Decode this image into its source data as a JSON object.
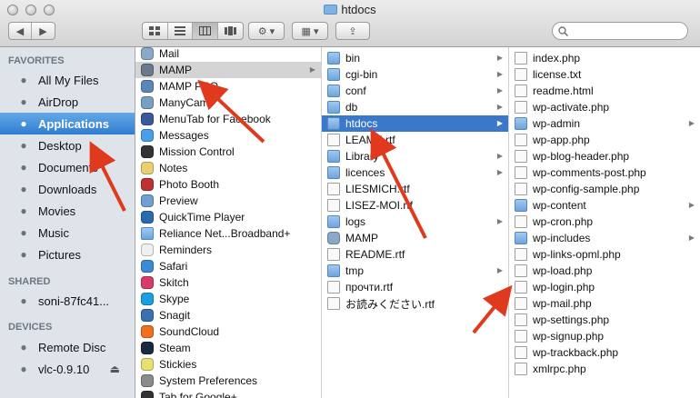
{
  "window": {
    "title": "htdocs"
  },
  "toolbar": {
    "view_icons": [
      "icon-view-icon",
      "list-view-icon",
      "column-view-icon",
      "coverflow-view-icon"
    ],
    "action_label": "⚙ ▾",
    "arrange_label": "▦ ▾",
    "share_label": "⇪"
  },
  "search": {
    "placeholder": ""
  },
  "sidebar": {
    "favorites_label": "FAVORITES",
    "favorites": [
      {
        "label": "All My Files",
        "icon": "all-files-icon"
      },
      {
        "label": "AirDrop",
        "icon": "airdrop-icon"
      },
      {
        "label": "Applications",
        "icon": "applications-icon",
        "selected": true
      },
      {
        "label": "Desktop",
        "icon": "desktop-icon"
      },
      {
        "label": "Documents",
        "icon": "documents-icon"
      },
      {
        "label": "Downloads",
        "icon": "downloads-icon"
      },
      {
        "label": "Movies",
        "icon": "movies-icon"
      },
      {
        "label": "Music",
        "icon": "music-icon"
      },
      {
        "label": "Pictures",
        "icon": "pictures-icon"
      }
    ],
    "shared_label": "SHARED",
    "shared": [
      {
        "label": "soni-87fc41...",
        "icon": "computer-icon"
      }
    ],
    "devices_label": "DEVICES",
    "devices": [
      {
        "label": "Remote Disc",
        "icon": "disc-icon"
      },
      {
        "label": "vlc-0.9.10",
        "icon": "drive-icon",
        "eject": "⏏"
      }
    ]
  },
  "columns": {
    "applications": [
      {
        "label": "Mail",
        "kind": "app",
        "color": "#8aa8c8"
      },
      {
        "label": "MAMP",
        "kind": "app",
        "color": "#6a7a8a",
        "highlighted": true,
        "chevron": true
      },
      {
        "label": "MAMP PRO",
        "kind": "app",
        "color": "#5b88b8"
      },
      {
        "label": "ManyCam",
        "kind": "app",
        "color": "#7aa0c0"
      },
      {
        "label": "MenuTab for Facebook",
        "kind": "app",
        "color": "#3b5998"
      },
      {
        "label": "Messages",
        "kind": "app",
        "color": "#4aa0e8"
      },
      {
        "label": "Mission Control",
        "kind": "app",
        "color": "#333333"
      },
      {
        "label": "Notes",
        "kind": "app",
        "color": "#e8d070"
      },
      {
        "label": "Photo Booth",
        "kind": "app",
        "color": "#c03030"
      },
      {
        "label": "Preview",
        "kind": "app",
        "color": "#6fa0d0"
      },
      {
        "label": "QuickTime Player",
        "kind": "app",
        "color": "#2a6ab0"
      },
      {
        "label": "Reliance Net...Broadband+",
        "kind": "folder",
        "color": "#7fb3e3"
      },
      {
        "label": "Reminders",
        "kind": "app",
        "color": "#f0f0f0"
      },
      {
        "label": "Safari",
        "kind": "app",
        "color": "#3a8ad8"
      },
      {
        "label": "Skitch",
        "kind": "app",
        "color": "#d83a6a"
      },
      {
        "label": "Skype",
        "kind": "app",
        "color": "#1aa0e0"
      },
      {
        "label": "Snagit",
        "kind": "app",
        "color": "#3a70b0"
      },
      {
        "label": "SoundCloud",
        "kind": "app",
        "color": "#f07020"
      },
      {
        "label": "Steam",
        "kind": "app",
        "color": "#1a2a40"
      },
      {
        "label": "Stickies",
        "kind": "app",
        "color": "#e8e070"
      },
      {
        "label": "System Preferences",
        "kind": "app",
        "color": "#8a8a8a"
      },
      {
        "label": "Tab for Google+",
        "kind": "app",
        "color": "#333333"
      }
    ],
    "mamp": [
      {
        "label": "bin",
        "kind": "folder",
        "chevron": true
      },
      {
        "label": "cgi-bin",
        "kind": "folder",
        "chevron": true
      },
      {
        "label": "conf",
        "kind": "folder",
        "chevron": true
      },
      {
        "label": "db",
        "kind": "folder",
        "chevron": true
      },
      {
        "label": "htdocs",
        "kind": "folder",
        "chevron": true,
        "selected": true
      },
      {
        "label": "LEAME.rtf",
        "kind": "doc"
      },
      {
        "label": "Library",
        "kind": "folder",
        "chevron": true
      },
      {
        "label": "licences",
        "kind": "folder",
        "chevron": true
      },
      {
        "label": "LIESMICH.rtf",
        "kind": "doc"
      },
      {
        "label": "LISEZ-MOI.rtf",
        "kind": "doc"
      },
      {
        "label": "logs",
        "kind": "folder",
        "chevron": true
      },
      {
        "label": "MAMP",
        "kind": "app"
      },
      {
        "label": "README.rtf",
        "kind": "doc"
      },
      {
        "label": "tmp",
        "kind": "folder",
        "chevron": true
      },
      {
        "label": "прочти.rtf",
        "kind": "doc"
      },
      {
        "label": "お読みください.rtf",
        "kind": "doc"
      }
    ],
    "htdocs": [
      {
        "label": "index.php",
        "kind": "doc"
      },
      {
        "label": "license.txt",
        "kind": "doc"
      },
      {
        "label": "readme.html",
        "kind": "doc"
      },
      {
        "label": "wp-activate.php",
        "kind": "doc"
      },
      {
        "label": "wp-admin",
        "kind": "folder",
        "chevron": true
      },
      {
        "label": "wp-app.php",
        "kind": "doc"
      },
      {
        "label": "wp-blog-header.php",
        "kind": "doc"
      },
      {
        "label": "wp-comments-post.php",
        "kind": "doc"
      },
      {
        "label": "wp-config-sample.php",
        "kind": "doc"
      },
      {
        "label": "wp-content",
        "kind": "folder",
        "chevron": true
      },
      {
        "label": "wp-cron.php",
        "kind": "doc"
      },
      {
        "label": "wp-includes",
        "kind": "folder",
        "chevron": true
      },
      {
        "label": "wp-links-opml.php",
        "kind": "doc"
      },
      {
        "label": "wp-load.php",
        "kind": "doc"
      },
      {
        "label": "wp-login.php",
        "kind": "doc"
      },
      {
        "label": "wp-mail.php",
        "kind": "doc"
      },
      {
        "label": "wp-settings.php",
        "kind": "doc"
      },
      {
        "label": "wp-signup.php",
        "kind": "doc"
      },
      {
        "label": "wp-trackback.php",
        "kind": "doc"
      },
      {
        "label": "xmlrpc.php",
        "kind": "doc"
      }
    ]
  },
  "annotation_arrows": [
    {
      "points_to": "Applications",
      "color": "#e03a1e"
    },
    {
      "points_to": "MAMP",
      "color": "#e03a1e"
    },
    {
      "points_to": "htdocs",
      "color": "#e03a1e"
    },
    {
      "points_to": "wp-login.php",
      "color": "#e03a1e"
    }
  ]
}
